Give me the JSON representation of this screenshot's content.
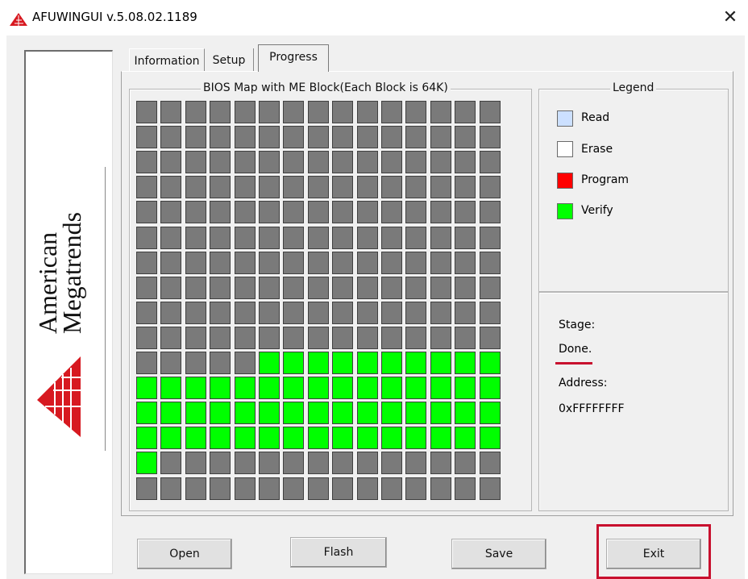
{
  "window": {
    "title": "AFUWINGUI v.5.08.02.1189",
    "close_glyph": "✕",
    "app_icon": "ami-triangle-icon"
  },
  "logo": {
    "line1": "American",
    "line2": "Megatrends"
  },
  "tabs": [
    {
      "label": "Information",
      "active": false
    },
    {
      "label": "Setup",
      "active": false
    },
    {
      "label": "Progress",
      "active": true
    }
  ],
  "bios_map": {
    "title": "BIOS Map with ME Block(Each Block is 64K)",
    "columns": 15,
    "rows": 16,
    "block_states": [
      "EEEEEEEEEEEEEEE",
      "EEEEEEEEEEEEEEE",
      "EEEEEEEEEEEEEEE",
      "EEEEEEEEEEEEEEE",
      "EEEEEEEEEEEEEEE",
      "EEEEEEEEEEEEEEE",
      "EEEEEEEEEEEEEEE",
      "EEEEEEEEEEEEEEE",
      "EEEEEEEEEEEEEEE",
      "EEEEEEEEEEEEEEE",
      "EEEEEVVVVVVVVVV",
      "VVVVVVVVVVVVVVV",
      "VVVVVVVVVVVVVVV",
      "VVVVVVVVVVVVVVV",
      "VEEEEEEEEEEEEEE",
      "EEEEEEEEEEEEEEE"
    ],
    "colors": {
      "empty": "#7a7a7a",
      "verify": "#00ff00"
    }
  },
  "legend": {
    "title": "Legend",
    "items": [
      {
        "label": "Read",
        "color": "#cce0ff"
      },
      {
        "label": "Erase",
        "color": "#ffffff"
      },
      {
        "label": "Program",
        "color": "#ff0000"
      },
      {
        "label": "Verify",
        "color": "#00ff00"
      }
    ]
  },
  "status": {
    "stage_label": "Stage:",
    "stage_value": "Done.",
    "address_label": "Address:",
    "address_value": "0xFFFFFFFF"
  },
  "buttons": {
    "open": "Open",
    "flash": "Flash",
    "save": "Save",
    "exit": "Exit"
  },
  "highlight_color": "#c8102e"
}
